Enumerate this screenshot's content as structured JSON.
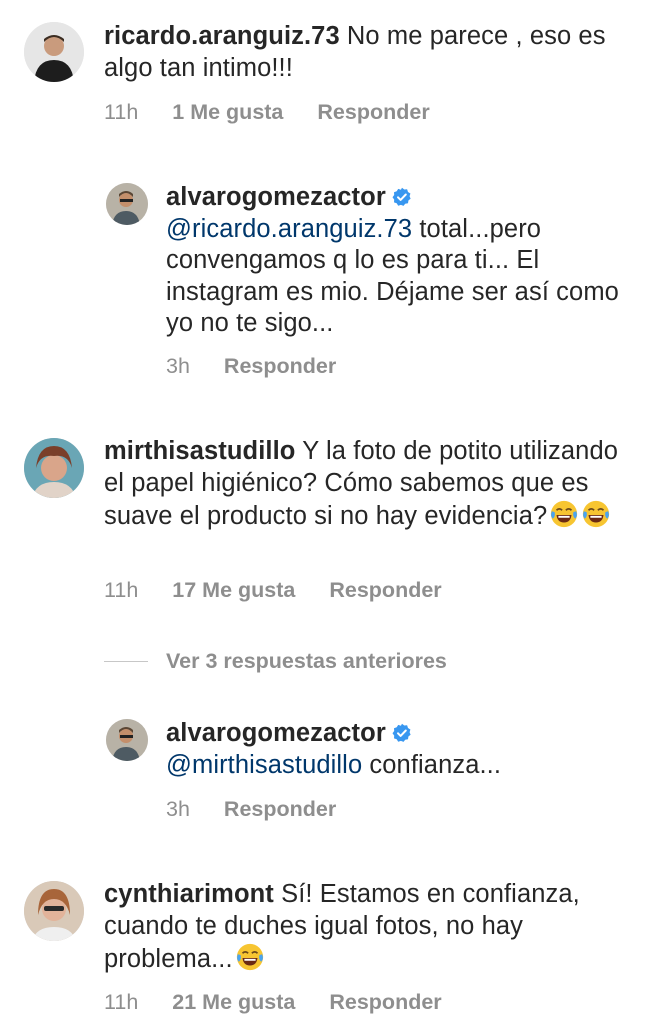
{
  "comments": [
    {
      "username": "ricardo.aranguiz.73",
      "body": " No me parece , eso es  algo tan intimo!!!",
      "time": "11h",
      "likes": "1 Me gusta",
      "reply": "Responder"
    },
    {
      "username": "alvarogomezactor",
      "mention": "@ricardo.aranguiz.73",
      "body": " total...pero convengamos q lo es para ti... El instagram es mio. Déjame ser así como yo no te sigo...",
      "time": "3h",
      "reply": "Responder"
    },
    {
      "username": "mirthisastudillo",
      "body": " Y la foto de potito utilizando el papel higiénico?  Cómo sabemos que es suave el producto si no hay evidencia?",
      "time": "11h",
      "likes": "17 Me gusta",
      "reply": "Responder"
    },
    {
      "username": "alvarogomezactor",
      "mention": "@mirthisastudillo",
      "body": " confianza...",
      "time": "3h",
      "reply": "Responder"
    },
    {
      "username": "cynthiarimont",
      "body": " Sí! Estamos en confianza, cuando te duches igual fotos, no hay problema...",
      "time": "11h",
      "likes": "21 Me gusta",
      "reply": "Responder"
    }
  ],
  "view_replies": "Ver 3 respuestas anteriores",
  "icons": {
    "verified": "verified-badge-icon",
    "emoji": "face-with-tears-of-joy-emoji"
  },
  "colors": {
    "text": "#262626",
    "meta": "#8e8e8e",
    "mention": "#00376b",
    "verified": "#3897f0"
  }
}
